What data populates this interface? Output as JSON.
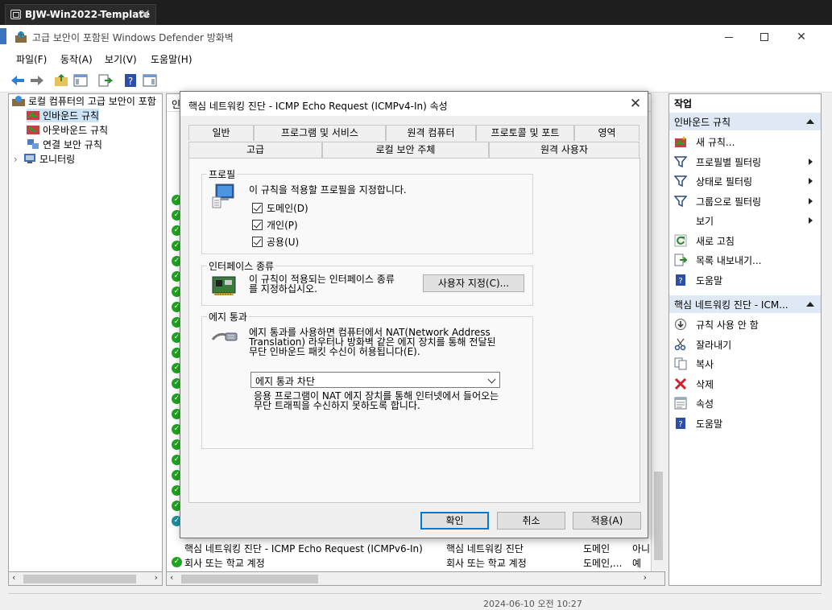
{
  "vm": {
    "tab_title": "BJW-Win2022-Template"
  },
  "window": {
    "title": "고급 보안이 포함된 Windows Defender 방화벽"
  },
  "menu": [
    "파일(F)",
    "동작(A)",
    "보기(V)",
    "도움말(H)"
  ],
  "tree": {
    "root": "로컬 컴퓨터의 고급 보안이 포함",
    "items": [
      "인바운드 규칙",
      "아웃바운드 규칙",
      "연결 보안 규칙",
      "모니터링"
    ]
  },
  "middle": {
    "header_partial": "인",
    "visible_rows": [
      {
        "name": "핵심 네트워킹 진단 - ICMP Echo Request (ICMPv6-In)",
        "group": "핵심 네트워킹 진단",
        "profile": "도메인",
        "enabled": "아니"
      },
      {
        "name": "회사 또는 학교 계정",
        "group": "회사 또는 학교 계정",
        "profile": "도메인,...",
        "enabled": "예"
      }
    ],
    "status_partial": "2024-06-10 오전 10:27"
  },
  "actions": {
    "header": "작업",
    "section1": "인바운드 규칙",
    "section1_items": [
      {
        "label": "새 규칙...",
        "icon": "new-rule-icon",
        "submenu": false
      },
      {
        "label": "프로필별 필터링",
        "icon": "filter-icon",
        "submenu": true
      },
      {
        "label": "상태로 필터링",
        "icon": "filter-icon",
        "submenu": true
      },
      {
        "label": "그룹으로 필터링",
        "icon": "filter-icon",
        "submenu": true
      },
      {
        "label": "보기",
        "icon": "",
        "submenu": true
      },
      {
        "label": "새로 고침",
        "icon": "refresh-icon",
        "submenu": false
      },
      {
        "label": "목록 내보내기...",
        "icon": "export-icon",
        "submenu": false
      },
      {
        "label": "도움말",
        "icon": "help-icon",
        "submenu": false
      }
    ],
    "section2": "핵심 네트워킹 진단 - ICM...",
    "section2_items": [
      {
        "label": "규칙 사용 안 함",
        "icon": "disable-icon"
      },
      {
        "label": "잘라내기",
        "icon": "cut-icon"
      },
      {
        "label": "복사",
        "icon": "copy-icon"
      },
      {
        "label": "삭제",
        "icon": "delete-icon"
      },
      {
        "label": "속성",
        "icon": "properties-icon"
      },
      {
        "label": "도움말",
        "icon": "help-icon"
      }
    ]
  },
  "dialog": {
    "title": "핵심 네트워킹 진단 - ICMP Echo Request (ICMPv4-In) 속성",
    "tabs_row1": [
      "일반",
      "프로그램 및 서비스",
      "원격 컴퓨터",
      "프로토콜 및 포트",
      "영역"
    ],
    "tabs_row2": [
      "고급",
      "로컬 보안 주체",
      "원격 사용자"
    ],
    "active_tab": "고급",
    "profile": {
      "title": "프로필",
      "desc": "이 규칙을 적용할 프로필을 지정합니다.",
      "domain": "도메인(D)",
      "private": "개인(P)",
      "public": "공용(U)"
    },
    "iface": {
      "title": "인터페이스 종류",
      "desc": "이 규칙이 적용되는 인터페이스 종류\n를 지정하십시오.",
      "button": "사용자 지정(C)..."
    },
    "edge": {
      "title": "에지 통과",
      "desc": "에지 통과를 사용하면 컴퓨터에서 NAT(Network Address\nTranslation) 라우터나 방화벽 같은 에지 장치를 통해 전달된\n무단 인바운드 패킷 수신이 허용됩니다(E).",
      "select_value": "에지 통과 차단",
      "note": "응용 프로그램이 NAT 에지 장치를 통해 인터넷에서 들어오는\n무단 트래픽을 수신하지 못하도록 합니다."
    },
    "buttons": {
      "ok": "확인",
      "cancel": "취소",
      "apply": "적용(A)"
    }
  }
}
